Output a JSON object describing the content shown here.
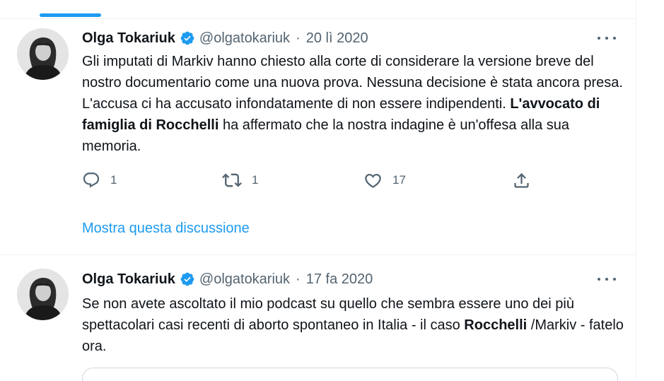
{
  "tweets": [
    {
      "name": "Olga Tokariuk",
      "handle": "@olgatokariuk",
      "separator": "·",
      "date": "20 lì 2020",
      "text_part1": "Gli imputati di Markiv hanno chiesto alla corte di considerare la versione breve del nostro documentario come una nuova prova. Nessuna decisione è stata ancora presa. L'accusa ci ha accusato infondatamente di non essere indipendenti. ",
      "text_bold": "L'avvocato di famiglia di Rocchelli",
      "text_part2": " ha affermato che la nostra indagine è un'offesa alla sua memoria.",
      "reply_count": "1",
      "retweet_count": "1",
      "like_count": "17",
      "show_thread": "Mostra questa discussione"
    },
    {
      "name": "Olga Tokariuk",
      "handle": "@olgatokariuk",
      "separator": "·",
      "date": "17 fa 2020",
      "text_part1": "Se non avete ascoltato il mio podcast su quello che sembra essere uno dei più spettacolari casi recenti di aborto spontaneo in Italia - il caso ",
      "text_bold": "Rocchelli",
      "text_part2": " /Markiv - fatelo ora."
    }
  ],
  "icons": {
    "reply": "reply-icon",
    "retweet": "retweet-icon",
    "like": "like-icon",
    "share": "share-icon",
    "verified": "verified-badge-icon",
    "more": "more-options-icon"
  },
  "colors": {
    "accent": "#1d9bf0",
    "text": "#0f1419",
    "muted": "#536471",
    "border": "#eff3f4"
  }
}
